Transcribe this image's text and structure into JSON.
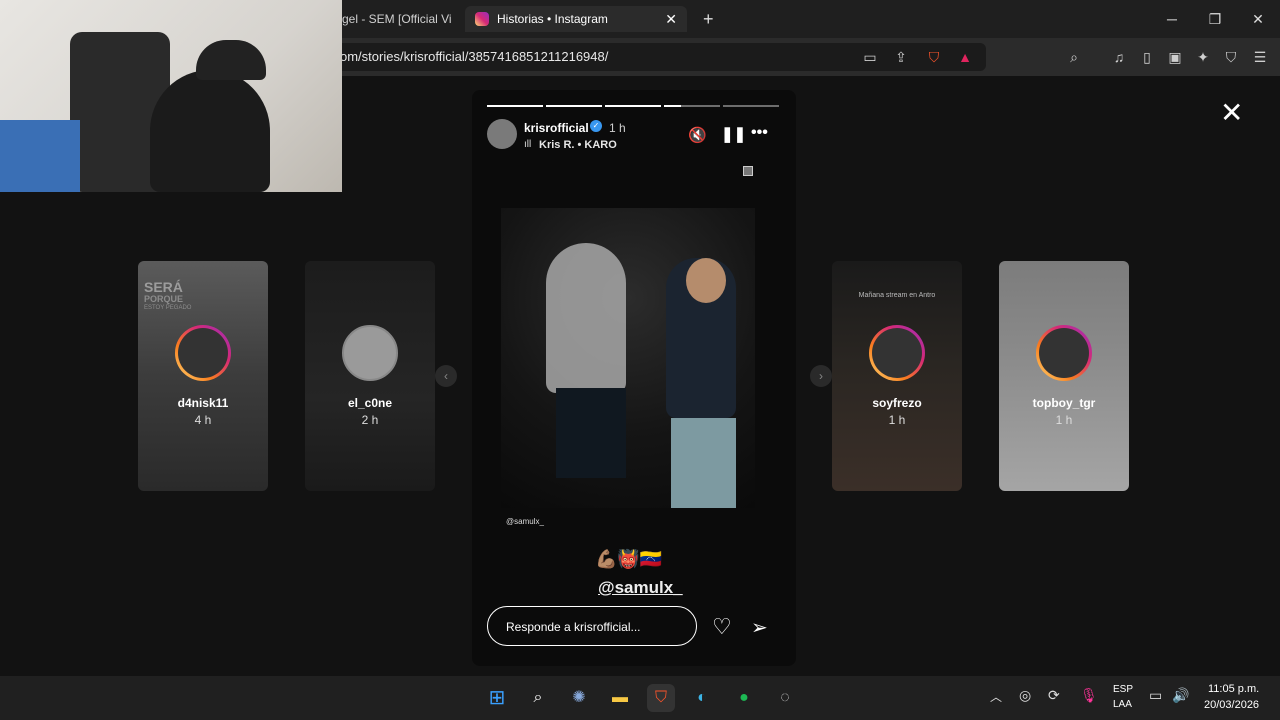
{
  "browser": {
    "tabs": [
      {
        "label": "gel - SEM [Official Vid",
        "active": false
      },
      {
        "label": "Historias • Instagram",
        "active": true
      }
    ],
    "new_tab": "+",
    "url": "om/stories/krisrofficial/3857416851211216948/",
    "window_controls": [
      "minimize-icon",
      "restore-icon",
      "close-icon"
    ]
  },
  "story": {
    "username": "krisrofficial",
    "verified": true,
    "time_ago": "1 h",
    "music": "Kris R. • KARO",
    "mention_small": "@samulx_",
    "emojis": "💪🏽👹🇻🇪",
    "mention_big": "@samulx_",
    "reply_placeholder": "Responde a krisrofficial...",
    "progress": [
      1,
      1,
      1,
      0.4,
      0,
      0
    ]
  },
  "previews": [
    {
      "name": "d4nisk11",
      "time": "4 h",
      "top_text": "SERÁ",
      "sub_text": "PORQUE",
      "sub2": "ESTOY PEGADO"
    },
    {
      "name": "el_c0ne",
      "time": "2 h"
    },
    {
      "name": "soyfrezo",
      "time": "1 h",
      "top_text": "Mañana stream en Antro"
    },
    {
      "name": "topboy_tgr",
      "time": "1 h"
    }
  ],
  "taskbar": {
    "lang": "ESP",
    "lang2": "LAA",
    "time": "11:05 p.m.",
    "date": "20/03/2026"
  }
}
